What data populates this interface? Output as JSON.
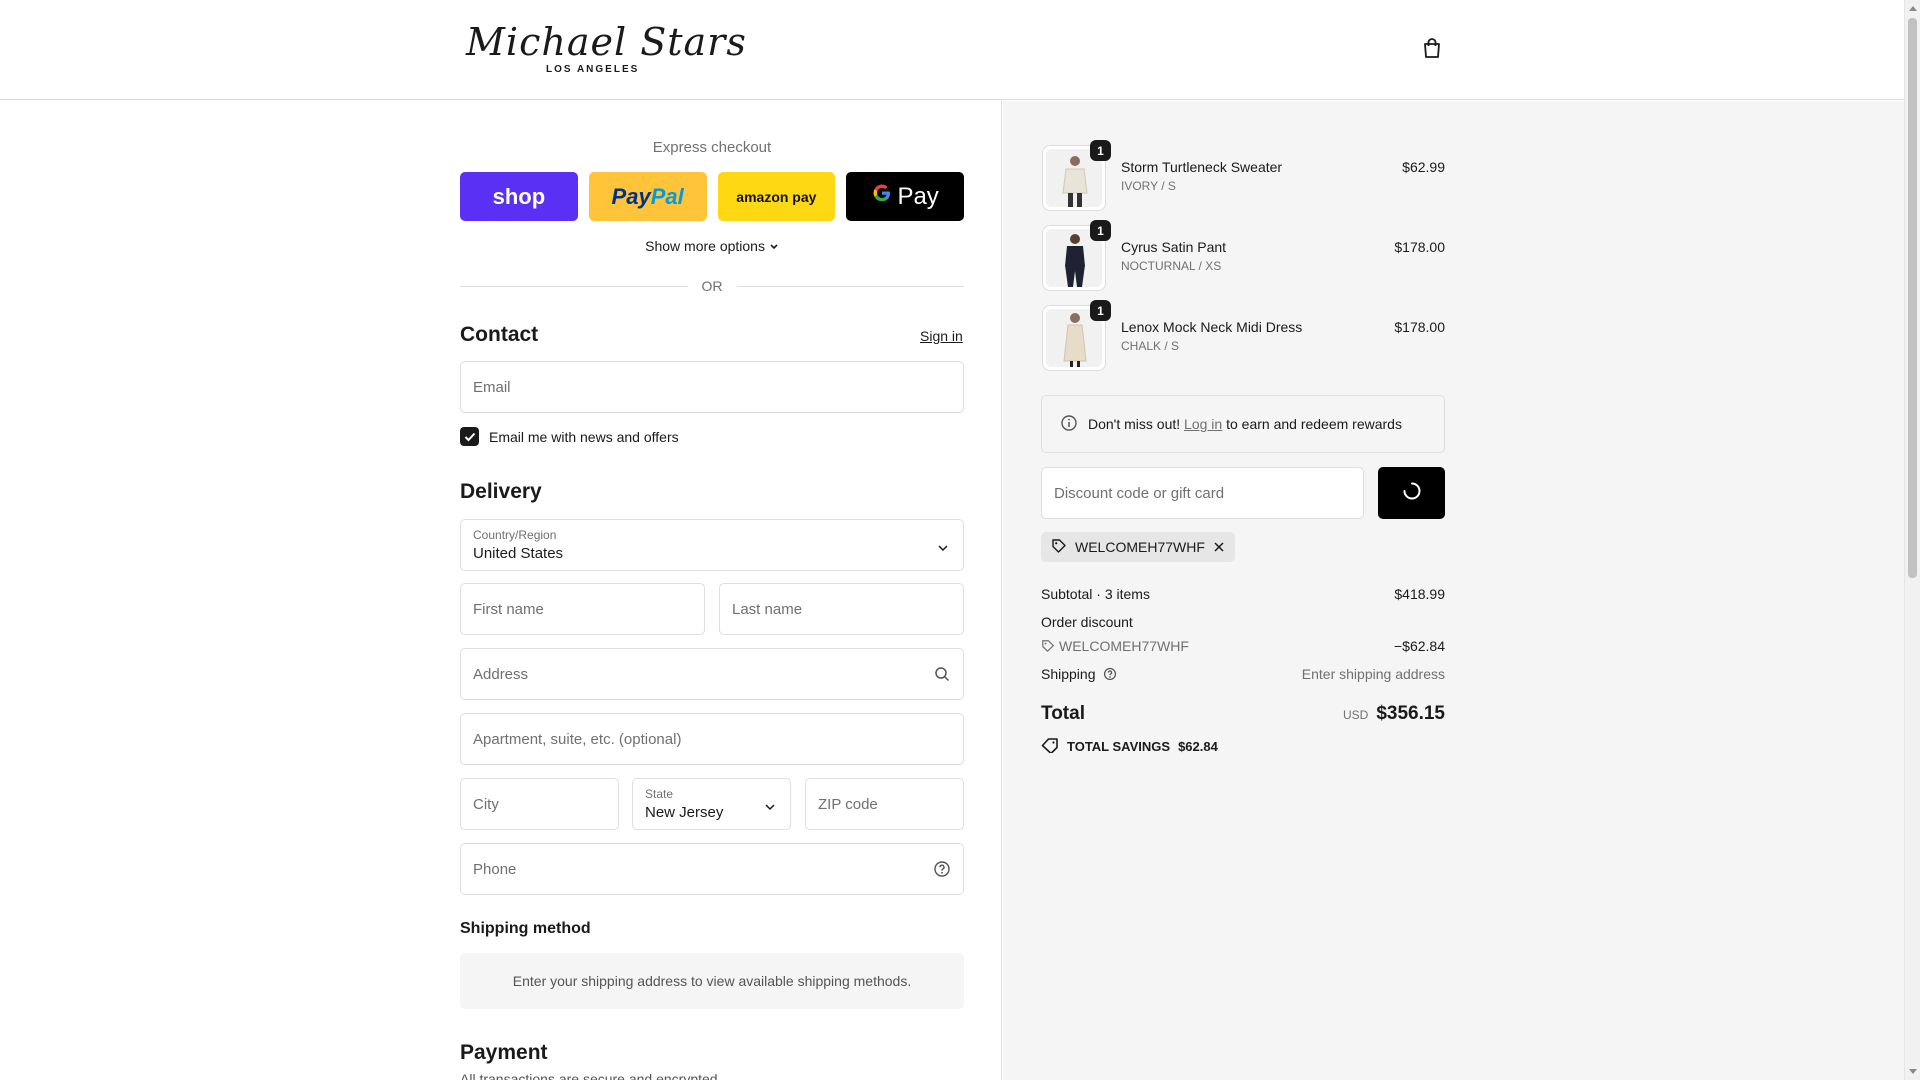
{
  "brand": {
    "name": "Michael Stars",
    "subtitle": "LOS ANGELES"
  },
  "express": {
    "title": "Express checkout",
    "shop_label": "shop",
    "paypal_part1": "Pay",
    "paypal_part2": "Pal",
    "amazon_label": "amazon pay",
    "gpay_label": "Pay",
    "more_options": "Show more options",
    "or": "OR"
  },
  "contact": {
    "title": "Contact",
    "signin": "Sign in",
    "email_placeholder": "Email",
    "newsletter_label": "Email me with news and offers",
    "newsletter_checked": true
  },
  "delivery": {
    "title": "Delivery",
    "country_label": "Country/Region",
    "country_value": "United States",
    "first_name_placeholder": "First name",
    "last_name_placeholder": "Last name",
    "address_placeholder": "Address",
    "apartment_placeholder": "Apartment, suite, etc. (optional)",
    "city_placeholder": "City",
    "state_label": "State",
    "state_value": "New Jersey",
    "zip_placeholder": "ZIP code",
    "phone_placeholder": "Phone"
  },
  "shipping_method": {
    "title": "Shipping method",
    "note": "Enter your shipping address to view available shipping methods."
  },
  "payment": {
    "title": "Payment",
    "subtitle": "All transactions are secure and encrypted."
  },
  "cart": {
    "items": [
      {
        "name": "Storm Turtleneck Sweater",
        "variant": "IVORY / S",
        "price": "$62.99",
        "qty": "1",
        "color": "#e9e4da"
      },
      {
        "name": "Cyrus Satin Pant",
        "variant": "NOCTURNAL / XS",
        "price": "$178.00",
        "qty": "1",
        "color": "#1f2233"
      },
      {
        "name": "Lenox Mock Neck Midi Dress",
        "variant": "CHALK / S",
        "price": "$178.00",
        "qty": "1",
        "color": "#e6dcc8"
      }
    ],
    "rewards_prefix": "Don't miss out!",
    "rewards_link": "Log in",
    "rewards_suffix": "to earn and redeem rewards",
    "discount_placeholder": "Discount code or gift card",
    "applied_code": "WELCOMEH77WHF"
  },
  "summary": {
    "subtotal_label": "Subtotal · 3 items",
    "subtotal_value": "$418.99",
    "order_discount_label": "Order discount",
    "discount_code": "WELCOMEH77WHF",
    "discount_value": "−$62.84",
    "shipping_label": "Shipping",
    "shipping_value": "Enter shipping address",
    "total_label": "Total",
    "currency": "USD",
    "total_value": "$356.15",
    "savings_label": "TOTAL SAVINGS",
    "savings_value": "$62.84"
  }
}
